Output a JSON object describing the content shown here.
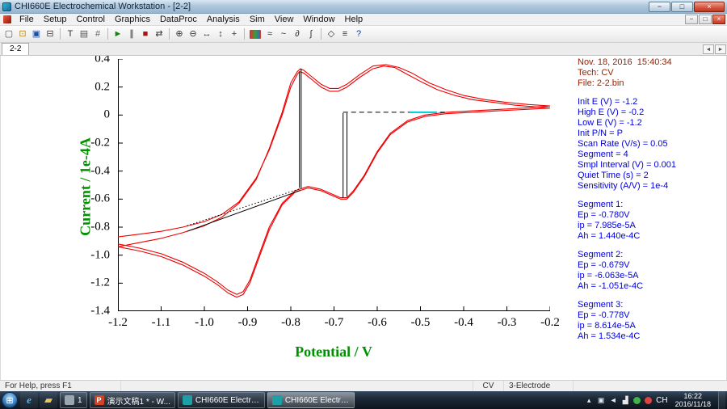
{
  "window": {
    "title": "CHI660E Electrochemical Workstation - [2-2]",
    "buttons": {
      "minimize": "−",
      "maximize": "□",
      "close": "×"
    },
    "mdi_buttons": [
      {
        "name": "mdi-minimize-button",
        "glyph": "−"
      },
      {
        "name": "mdi-restore-button",
        "glyph": "□"
      },
      {
        "name": "mdi-close-button",
        "glyph": "×",
        "close": true
      }
    ]
  },
  "menu": {
    "items": [
      "File",
      "Setup",
      "Control",
      "Graphics",
      "DataProc",
      "Analysis",
      "Sim",
      "View",
      "Window",
      "Help"
    ]
  },
  "toolbar": {
    "icons": [
      {
        "name": "new-file-icon",
        "glyph": "▢",
        "color": "#555555"
      },
      {
        "name": "open-file-icon",
        "glyph": "⊡",
        "color": "#b8860b"
      },
      {
        "name": "save-icon",
        "glyph": "▣",
        "color": "#1f4fa0"
      },
      {
        "name": "print-icon",
        "glyph": "⊟",
        "color": "#444444"
      },
      {
        "sep": true
      },
      {
        "name": "text-tool-icon",
        "glyph": "T",
        "color": "#333333"
      },
      {
        "name": "copy-icon",
        "glyph": "▤",
        "color": "#555555"
      },
      {
        "name": "grid-icon",
        "glyph": "#",
        "color": "#666666"
      },
      {
        "sep": true
      },
      {
        "name": "run-experiment-icon",
        "glyph": "►",
        "color": "#0a8a0a"
      },
      {
        "name": "pause-icon",
        "glyph": "∥",
        "color": "#333333"
      },
      {
        "name": "stop-icon",
        "glyph": "■",
        "color": "#b01010"
      },
      {
        "name": "reverse-scan-icon",
        "glyph": "⇄",
        "color": "#333333"
      },
      {
        "sep": true
      },
      {
        "name": "zoom-in-icon",
        "glyph": "⊕",
        "color": "#333333"
      },
      {
        "name": "zoom-out-icon",
        "glyph": "⊖",
        "color": "#333333"
      },
      {
        "name": "expand-x-icon",
        "glyph": "↔",
        "color": "#333333"
      },
      {
        "name": "expand-y-icon",
        "glyph": "↕",
        "color": "#333333"
      },
      {
        "name": "crosshair-icon",
        "glyph": "+",
        "color": "#333333"
      },
      {
        "sep": true
      },
      {
        "name": "palette-icon",
        "glyph": "",
        "bg": "linear-gradient(90deg,#dd3333,#33a033,#3366cc)"
      },
      {
        "name": "overlay-plots-icon",
        "glyph": "≈",
        "color": "#333333"
      },
      {
        "name": "smooth-icon",
        "glyph": "~",
        "color": "#333333"
      },
      {
        "name": "derivative-icon",
        "glyph": "∂",
        "color": "#333333"
      },
      {
        "name": "integration-icon",
        "glyph": "∫",
        "color": "#333333"
      },
      {
        "sep": true
      },
      {
        "name": "marker-icon",
        "glyph": "◇",
        "color": "#333333"
      },
      {
        "name": "data-list-icon",
        "glyph": "≡",
        "color": "#333333"
      },
      {
        "name": "help-icon",
        "glyph": "?",
        "color": "#1040a0"
      }
    ]
  },
  "tabs": {
    "active": "2-2",
    "scroll_left_glyph": "◄",
    "scroll_right_glyph": "►"
  },
  "plot": {
    "axis_title_color": "#009100",
    "curve_color": "#ee0000"
  },
  "chart_data": {
    "type": "line",
    "title": "",
    "xlabel": "Potential / V",
    "ylabel": "Current / 1e-4A",
    "xlim": [
      -1.2,
      -0.2
    ],
    "ylim": [
      -1.4,
      0.4
    ],
    "grid": false,
    "legend": "none",
    "x_ticks": [
      "-1.2",
      "-1.1",
      "-1.0",
      "-0.9",
      "-0.8",
      "-0.7",
      "-0.6",
      "-0.5",
      "-0.4",
      "-0.3",
      "-0.2"
    ],
    "y_ticks": [
      "0.4",
      "0.2",
      "0",
      "-0.2",
      "-0.4",
      "-0.6",
      "-0.8",
      "-1.0",
      "-1.2",
      "-1.4"
    ],
    "series": [
      {
        "name": "cv-cycle-1",
        "color": "#ee0000",
        "points": [
          [
            -1.2,
            -0.87
          ],
          [
            -1.15,
            -0.85
          ],
          [
            -1.1,
            -0.83
          ],
          [
            -1.05,
            -0.8
          ],
          [
            -1.0,
            -0.76
          ],
          [
            -0.96,
            -0.71
          ],
          [
            -0.92,
            -0.62
          ],
          [
            -0.88,
            -0.45
          ],
          [
            -0.85,
            -0.25
          ],
          [
            -0.82,
            0.0
          ],
          [
            -0.8,
            0.2
          ],
          [
            -0.785,
            0.29
          ],
          [
            -0.78,
            0.31
          ],
          [
            -0.77,
            0.3
          ],
          [
            -0.75,
            0.25
          ],
          [
            -0.73,
            0.2
          ],
          [
            -0.71,
            0.17
          ],
          [
            -0.69,
            0.17
          ],
          [
            -0.67,
            0.2
          ],
          [
            -0.64,
            0.27
          ],
          [
            -0.61,
            0.33
          ],
          [
            -0.585,
            0.35
          ],
          [
            -0.56,
            0.34
          ],
          [
            -0.53,
            0.29
          ],
          [
            -0.5,
            0.24
          ],
          [
            -0.46,
            0.18
          ],
          [
            -0.42,
            0.14
          ],
          [
            -0.38,
            0.11
          ],
          [
            -0.33,
            0.09
          ],
          [
            -0.28,
            0.07
          ],
          [
            -0.24,
            0.06
          ],
          [
            -0.2,
            0.05
          ],
          [
            -0.26,
            0.04
          ],
          [
            -0.32,
            0.03
          ],
          [
            -0.38,
            0.02
          ],
          [
            -0.44,
            0.01
          ],
          [
            -0.49,
            -0.01
          ],
          [
            -0.53,
            -0.05
          ],
          [
            -0.57,
            -0.14
          ],
          [
            -0.6,
            -0.27
          ],
          [
            -0.63,
            -0.44
          ],
          [
            -0.655,
            -0.55
          ],
          [
            -0.67,
            -0.6
          ],
          [
            -0.685,
            -0.6
          ],
          [
            -0.7,
            -0.58
          ],
          [
            -0.73,
            -0.54
          ],
          [
            -0.76,
            -0.52
          ],
          [
            -0.79,
            -0.55
          ],
          [
            -0.82,
            -0.64
          ],
          [
            -0.85,
            -0.82
          ],
          [
            -0.875,
            -1.03
          ],
          [
            -0.895,
            -1.2
          ],
          [
            -0.91,
            -1.28
          ],
          [
            -0.925,
            -1.3
          ],
          [
            -0.945,
            -1.27
          ],
          [
            -0.97,
            -1.21
          ],
          [
            -1.0,
            -1.15
          ],
          [
            -1.05,
            -1.07
          ],
          [
            -1.1,
            -1.01
          ],
          [
            -1.15,
            -0.97
          ],
          [
            -1.2,
            -0.94
          ]
        ]
      },
      {
        "name": "cv-cycle-2",
        "color": "#ee0000",
        "points": [
          [
            -1.2,
            -0.94
          ],
          [
            -1.15,
            -0.91
          ],
          [
            -1.1,
            -0.88
          ],
          [
            -1.05,
            -0.84
          ],
          [
            -1.0,
            -0.79
          ],
          [
            -0.96,
            -0.73
          ],
          [
            -0.92,
            -0.63
          ],
          [
            -0.88,
            -0.46
          ],
          [
            -0.85,
            -0.24
          ],
          [
            -0.82,
            0.02
          ],
          [
            -0.8,
            0.23
          ],
          [
            -0.785,
            0.31
          ],
          [
            -0.778,
            0.33
          ],
          [
            -0.77,
            0.32
          ],
          [
            -0.75,
            0.27
          ],
          [
            -0.73,
            0.22
          ],
          [
            -0.71,
            0.19
          ],
          [
            -0.69,
            0.19
          ],
          [
            -0.67,
            0.22
          ],
          [
            -0.64,
            0.29
          ],
          [
            -0.61,
            0.35
          ],
          [
            -0.58,
            0.36
          ],
          [
            -0.55,
            0.34
          ],
          [
            -0.52,
            0.3
          ],
          [
            -0.48,
            0.23
          ],
          [
            -0.44,
            0.18
          ],
          [
            -0.4,
            0.14
          ],
          [
            -0.35,
            0.11
          ],
          [
            -0.3,
            0.09
          ],
          [
            -0.25,
            0.075
          ],
          [
            -0.2,
            0.065
          ],
          [
            -0.26,
            0.05
          ],
          [
            -0.32,
            0.04
          ],
          [
            -0.38,
            0.03
          ],
          [
            -0.44,
            0.02
          ],
          [
            -0.49,
            0.0
          ],
          [
            -0.53,
            -0.04
          ],
          [
            -0.57,
            -0.13
          ],
          [
            -0.6,
            -0.26
          ],
          [
            -0.63,
            -0.43
          ],
          [
            -0.655,
            -0.54
          ],
          [
            -0.67,
            -0.59
          ],
          [
            -0.685,
            -0.59
          ],
          [
            -0.7,
            -0.57
          ],
          [
            -0.73,
            -0.53
          ],
          [
            -0.76,
            -0.51
          ],
          [
            -0.79,
            -0.54
          ],
          [
            -0.82,
            -0.63
          ],
          [
            -0.85,
            -0.8
          ],
          [
            -0.875,
            -1.01
          ],
          [
            -0.895,
            -1.18
          ],
          [
            -0.91,
            -1.26
          ],
          [
            -0.925,
            -1.28
          ],
          [
            -0.945,
            -1.25
          ],
          [
            -0.97,
            -1.19
          ],
          [
            -1.0,
            -1.13
          ],
          [
            -1.05,
            -1.05
          ],
          [
            -1.1,
            -0.99
          ],
          [
            -1.15,
            -0.95
          ],
          [
            -1.2,
            -0.92
          ]
        ]
      }
    ],
    "annotations": [
      {
        "name": "peak1-drop-line-a",
        "style": "solid",
        "color": "#000000",
        "points": [
          [
            -0.78,
            0.31
          ],
          [
            -0.78,
            -0.52
          ]
        ]
      },
      {
        "name": "peak1-drop-line-b",
        "style": "solid",
        "color": "#000000",
        "points": [
          [
            -0.776,
            0.33
          ],
          [
            -0.776,
            -0.522
          ]
        ]
      },
      {
        "name": "peak1-baseline-dotted",
        "style": "dotted",
        "color": "#000000",
        "points": [
          [
            -1.04,
            -0.79
          ],
          [
            -0.778,
            -0.525
          ]
        ]
      },
      {
        "name": "peak1-baseline-solid",
        "style": "solid",
        "color": "#000000",
        "points": [
          [
            -1.04,
            -0.83
          ],
          [
            -0.778,
            -0.538
          ]
        ]
      },
      {
        "name": "peak2-baseline-dashed",
        "style": "dashed",
        "color": "#000000",
        "points": [
          [
            -0.679,
            0.02
          ],
          [
            -0.436,
            0.02
          ]
        ]
      },
      {
        "name": "peak2-drop-line-a",
        "style": "solid",
        "color": "#000000",
        "points": [
          [
            -0.679,
            0.015
          ],
          [
            -0.679,
            -0.592
          ]
        ]
      },
      {
        "name": "peak2-drop-line-b",
        "style": "solid",
        "color": "#000000",
        "points": [
          [
            -0.67,
            0.015
          ],
          [
            -0.67,
            -0.583
          ]
        ]
      },
      {
        "name": "baseline-highlight",
        "style": "solid",
        "color": "#00c8d8",
        "width": 2,
        "points": [
          [
            -0.525,
            0.02
          ],
          [
            -0.462,
            0.02
          ]
        ]
      }
    ]
  },
  "info_panel": {
    "blocks": [
      {
        "name": "file-info-block",
        "color": "#992200",
        "lines": [
          "Nov. 18, 2016  15:40:34",
          "Tech: CV",
          "File: 2-2.bin"
        ]
      },
      {
        "name": "parameters-block",
        "color": "#0000dd",
        "lines": [
          "Init E (V) = -1.2",
          "High E (V) = -0.2",
          "Low E (V) = -1.2",
          "Init P/N = P",
          "Scan Rate (V/s) = 0.05",
          "Segment = 4",
          "Smpl Interval (V) = 0.001",
          "Quiet Time (s) = 2",
          "Sensitivity (A/V) = 1e-4"
        ]
      },
      {
        "name": "segment-1-results",
        "color": "#0000dd",
        "lines": [
          "Segment 1:",
          "Ep = -0.780V",
          "ip = 7.985e-5A",
          "Ah = 1.440e-4C"
        ]
      },
      {
        "name": "segment-2-results",
        "color": "#0000dd",
        "lines": [
          "Segment 2:",
          "Ep = -0.679V",
          "ip = -6.063e-5A",
          "Ah = -1.051e-4C"
        ]
      },
      {
        "name": "segment-3-results",
        "color": "#0000dd",
        "lines": [
          "Segment 3:",
          "Ep = -0.778V",
          "ip = 8.614e-5A",
          "Ah = 1.534e-4C"
        ]
      }
    ]
  },
  "statusbar": {
    "help": "For Help, press F1",
    "tech": "CV",
    "electrode": "3-Electrode"
  },
  "taskbar": {
    "start_glyph": "⊞",
    "language": "CH",
    "quick_icons": [
      {
        "name": "internet-explorer-icon",
        "glyph": "e",
        "color": "#56b8ef",
        "italic": true
      },
      {
        "name": "explorer-folder-icon",
        "glyph": "▰",
        "color": "#eac45e"
      }
    ],
    "apps": [
      {
        "name": "taskbar-app-1",
        "label": "1",
        "icon_color": "#9aa7b0",
        "active": false
      },
      {
        "name": "taskbar-powerpoint",
        "label": "演示文稿1 * - W...",
        "icon_color": "#d04423",
        "icon_glyph": "P",
        "active": false
      },
      {
        "name": "taskbar-chi660e-1",
        "label": "CHI660E Electro...",
        "icon_color": "#1d9fa8",
        "active": false
      },
      {
        "name": "taskbar-chi660e-2",
        "label": "CHI660E Electro...",
        "icon_color": "#1d9fa8",
        "active": true
      }
    ],
    "tray_icons": [
      {
        "name": "hidden-icons-button",
        "glyph": "▴",
        "color": "#e8e8e8"
      },
      {
        "name": "ime-mode-icon",
        "glyph": "▣",
        "color": "#dfe7ee"
      },
      {
        "name": "volume-icon",
        "glyph": "◄",
        "color": "#e8e8e8"
      },
      {
        "name": "network-icon",
        "glyph": "▟",
        "color": "#e8e8e8"
      },
      {
        "name": "security-tray-icon",
        "dot": "#3db54a"
      },
      {
        "name": "alert-tray-icon",
        "dot": "#e04343"
      }
    ],
    "clock": {
      "time": "16:22",
      "date": "2016/11/18"
    }
  }
}
